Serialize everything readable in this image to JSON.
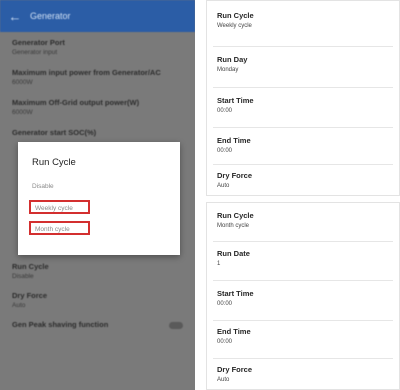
{
  "phone": {
    "appbar": {
      "title": "Generator"
    },
    "settings": [
      {
        "title": "Generator Port",
        "sub": "Generator input"
      },
      {
        "title": "Maximum input power from Generator/AC",
        "sub": "6000W"
      },
      {
        "title": "Maximum Off-Grid output power(W)",
        "sub": "6000W"
      },
      {
        "title": "Generator start SOC(%)",
        "sub": ""
      }
    ],
    "settings_after": [
      {
        "title": "Run Cycle",
        "sub": "Disable"
      },
      {
        "title": "Dry Force",
        "sub": "Auto"
      },
      {
        "title": "Gen Peak shaving function",
        "sub": "",
        "toggle": true
      }
    ],
    "dialog": {
      "title": "Run Cycle",
      "options": [
        "Disable",
        "Weekly cycle",
        "Month cycle"
      ]
    }
  },
  "panel_weekly": {
    "fields": [
      {
        "label": "Run Cycle",
        "value": "Weekly cycle"
      },
      {
        "label": "Run Day",
        "value": "Monday"
      },
      {
        "label": "Start Time",
        "value": "00:00"
      },
      {
        "label": "End Time",
        "value": "00:00"
      },
      {
        "label": "Dry Force",
        "value": "Auto"
      }
    ]
  },
  "panel_month": {
    "fields": [
      {
        "label": "Run Cycle",
        "value": "Month cycle"
      },
      {
        "label": "Run Date",
        "value": "1"
      },
      {
        "label": "Start Time",
        "value": "00:00"
      },
      {
        "label": "End Time",
        "value": "00:00"
      },
      {
        "label": "Dry Force",
        "value": "Auto"
      }
    ]
  },
  "colors": {
    "appbar": "#2b5da6",
    "overlay": "#7a7a7a",
    "highlight_border": "#d32f2f"
  }
}
